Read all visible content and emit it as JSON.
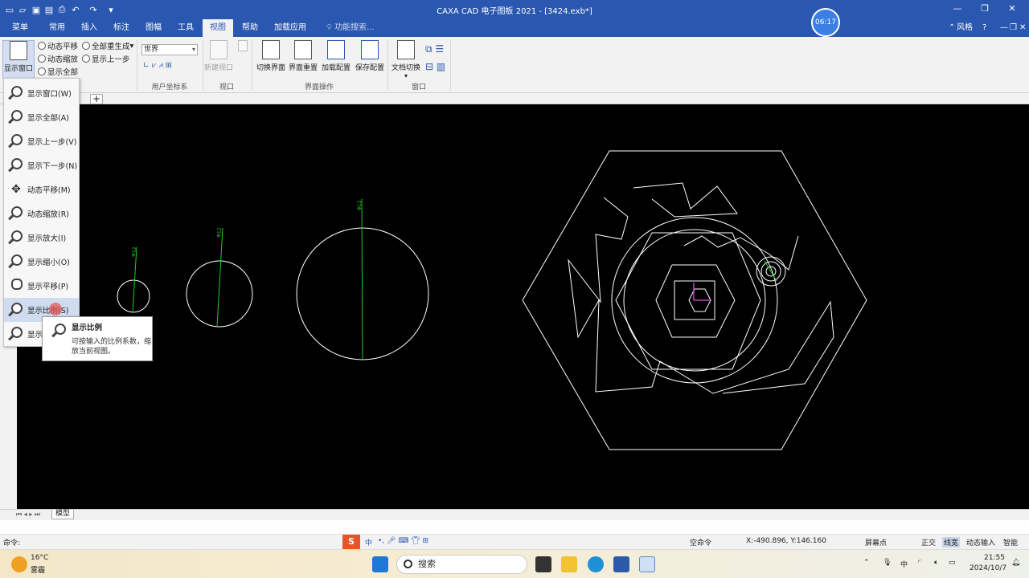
{
  "titlebar": {
    "title": "CAXA CAD 电子图板 2021 - [3424.exb*]",
    "quick_icons": [
      "new-file-icon",
      "open-folder-icon",
      "save-icon",
      "save-all-icon",
      "print-icon",
      "undo-icon",
      "redo-icon",
      "customize-icon"
    ],
    "window_buttons": [
      "—",
      "❐",
      "✕"
    ]
  },
  "menu": {
    "tabs": [
      "菜单",
      "常用",
      "插入",
      "标注",
      "图幅",
      "工具",
      "视图",
      "帮助",
      "加载应用"
    ],
    "active_tab": "视图",
    "search_placeholder": "功能搜索...",
    "timer": "06:17",
    "style_label": "风格",
    "help_icon": "?"
  },
  "ribbon": {
    "display_window_big": "显示窗口",
    "small_buttons": [
      "动态平移",
      "全部重生成",
      "动态缩放",
      "显示上一步",
      "显示全部"
    ],
    "ucs_value": "世界",
    "ucs_group": "用户坐标系",
    "new_viewport": "新建视口",
    "viewport_group": "视口",
    "interface_buttons": [
      "切换界面",
      "界面重置",
      "加载配置",
      "保存配置"
    ],
    "interface_group": "界面操作",
    "doc_switch": "文档切换",
    "window_group": "窗口"
  },
  "dropdown": {
    "items": [
      {
        "label": "显示窗口(W)",
        "icon": "zoom-window-icon"
      },
      {
        "label": "显示全部(A)",
        "icon": "zoom-all-icon"
      },
      {
        "label": "显示上一步(V)",
        "icon": "zoom-previous-icon"
      },
      {
        "label": "显示下一步(N)",
        "icon": "zoom-next-icon"
      },
      {
        "label": "动态平移(M)",
        "icon": "pan-icon"
      },
      {
        "label": "动态缩放(R)",
        "icon": "zoom-dynamic-icon"
      },
      {
        "label": "显示放大(I)",
        "icon": "zoom-in-icon"
      },
      {
        "label": "显示缩小(O)",
        "icon": "zoom-out-icon"
      },
      {
        "label": "显示平移(P)",
        "icon": "pan-view-icon"
      },
      {
        "label": "显示比例(S)",
        "icon": "zoom-scale-icon"
      },
      {
        "label": "显示",
        "icon": "zoom-center-icon"
      }
    ],
    "hovered_index": 9
  },
  "tooltip": {
    "title": "显示比例",
    "body": "可按输入的比例系数，缩放当前视图。"
  },
  "drawing": {
    "dimension_labels": [
      "Φ12",
      "Φ12",
      "Φ12"
    ]
  },
  "model_tab": "模型",
  "command": {
    "prompt": "命令:",
    "empty_command": "空命令",
    "coords": "X:-490.896, Y:146.160"
  },
  "status_toggles": [
    "屏幕点",
    "正交",
    "线宽",
    "动态输入",
    "智能"
  ],
  "status_active": "线宽",
  "ime": {
    "label": "中"
  },
  "taskbar": {
    "weather_temp": "16°C",
    "weather_desc": "雾霾",
    "search_label": "搜索",
    "time": "21:55",
    "date": "2024/10/7"
  },
  "colors": {
    "title_blue": "#2a57b0",
    "canvas": "#000000",
    "drawing_white": "#ffffff",
    "dim_green": "#22cc22",
    "axis_magenta": "#c040c0"
  }
}
